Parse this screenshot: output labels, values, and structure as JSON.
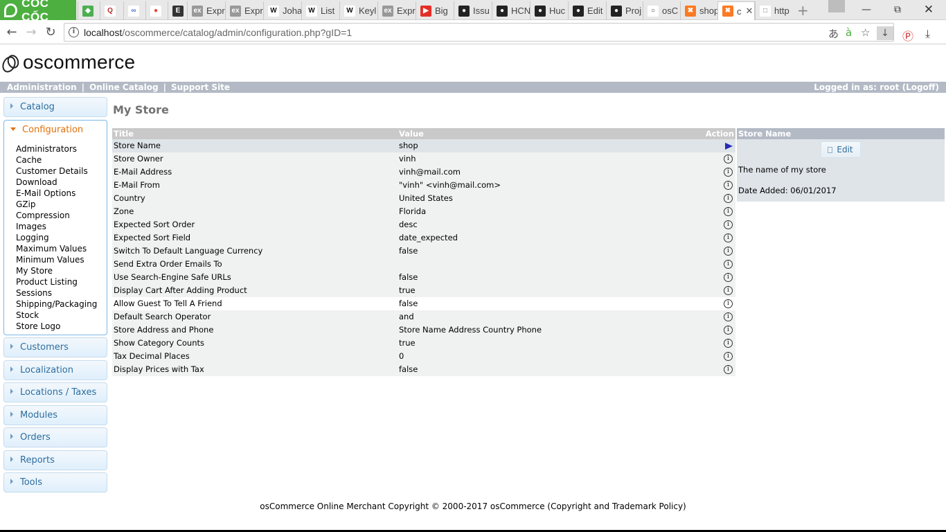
{
  "browser": {
    "brand": "CỐC CỐC",
    "tabs": [
      {
        "label": "",
        "icon": "green-diamond-icon"
      },
      {
        "label": "",
        "icon": "quora-icon"
      },
      {
        "label": "",
        "icon": "link-icon"
      },
      {
        "label": "",
        "icon": "chrome-webstore-icon"
      },
      {
        "label": "",
        "icon": "e-app-icon"
      },
      {
        "label": "Expr",
        "icon": "ex-icon"
      },
      {
        "label": "Expr",
        "icon": "ex-icon"
      },
      {
        "label": "Joha",
        "icon": "wikipedia-icon"
      },
      {
        "label": "List",
        "icon": "wikipedia-icon"
      },
      {
        "label": "Keyl",
        "icon": "wikipedia-icon"
      },
      {
        "label": "Expr",
        "icon": "ex-icon"
      },
      {
        "label": "Big",
        "icon": "youtube-icon"
      },
      {
        "label": "Issu",
        "icon": "github-icon"
      },
      {
        "label": "HCN",
        "icon": "github-icon"
      },
      {
        "label": "Huc",
        "icon": "github-icon"
      },
      {
        "label": "Edit",
        "icon": "github-icon"
      },
      {
        "label": "Proj",
        "icon": "github-icon"
      },
      {
        "label": "osC",
        "icon": "oscommerce-icon"
      },
      {
        "label": "shop",
        "icon": "xampp-icon"
      },
      {
        "label": "c",
        "icon": "xampp-icon"
      },
      {
        "label": "http",
        "icon": "page-icon"
      }
    ],
    "url_host": "localhost",
    "url_path": "/oscommerce/catalog/admin/configuration.php?gID=1"
  },
  "logo_text": "oscommerce",
  "header": {
    "links": [
      "Administration",
      "Online Catalog",
      "Support Site"
    ],
    "separator": "|",
    "logged_in_prefix": "Logged in as: root (",
    "logoff": "Logoff",
    "logged_in_suffix": ")"
  },
  "sidebar": {
    "catalog": "Catalog",
    "configuration": "Configuration",
    "config_items": [
      "Administrators",
      "Cache",
      "Customer Details",
      "Download",
      "E-Mail Options",
      "GZip",
      "Compression",
      "Images",
      "Logging",
      "Maximum Values",
      "Minimum Values",
      "My Store",
      "Product Listing",
      "Sessions",
      "Shipping/Packaging",
      "Stock",
      "Store Logo"
    ],
    "others": [
      "Customers",
      "Localization",
      "Locations / Taxes",
      "Modules",
      "Orders",
      "Reports",
      "Tools"
    ]
  },
  "page_title": "My Store",
  "table": {
    "headers": {
      "title": "Title",
      "value": "Value",
      "action": "Action"
    },
    "rows": [
      {
        "title": "Store Name",
        "value": "shop"
      },
      {
        "title": "Store Owner",
        "value": "vinh"
      },
      {
        "title": "E-Mail Address",
        "value": "vinh@mail.com"
      },
      {
        "title": "E-Mail From",
        "value": "\"vinh\" <vinh@mail.com>"
      },
      {
        "title": "Country",
        "value": "United States"
      },
      {
        "title": "Zone",
        "value": "Florida"
      },
      {
        "title": "Expected Sort Order",
        "value": "desc"
      },
      {
        "title": "Expected Sort Field",
        "value": "date_expected"
      },
      {
        "title": "Switch To Default Language Currency",
        "value": "false"
      },
      {
        "title": "Send Extra Order Emails To",
        "value": ""
      },
      {
        "title": "Use Search-Engine Safe URLs",
        "value": "false"
      },
      {
        "title": "Display Cart After Adding Product",
        "value": "true"
      },
      {
        "title": "Allow Guest To Tell A Friend",
        "value": "false"
      },
      {
        "title": "Default Search Operator",
        "value": "and"
      },
      {
        "title": "Store Address and Phone",
        "value": "Store Name Address Country Phone"
      },
      {
        "title": "Show Category Counts",
        "value": "true"
      },
      {
        "title": "Tax Decimal Places",
        "value": "0"
      },
      {
        "title": "Display Prices with Tax",
        "value": "false"
      }
    ],
    "selected_index": 0,
    "hover_index": 12
  },
  "infobox": {
    "heading": "Store Name",
    "edit_label": "Edit",
    "description": "The name of my store",
    "date_added": "Date Added: 06/01/2017"
  },
  "footer": "osCommerce Online Merchant Copyright © 2000-2017 osCommerce (Copyright and Trademark Policy)"
}
